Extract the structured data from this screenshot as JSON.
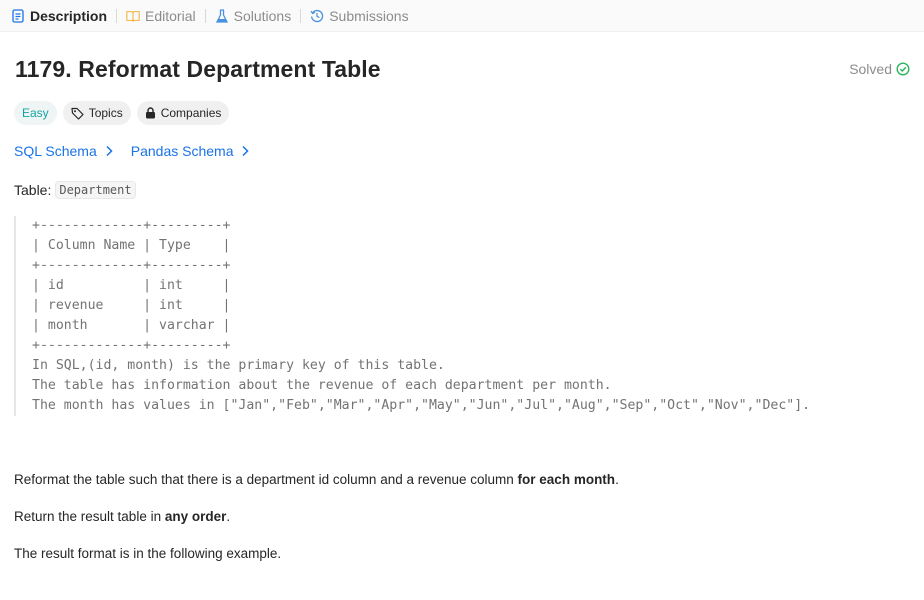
{
  "tabs": [
    {
      "label": "Description",
      "icon": "description-icon",
      "active": true
    },
    {
      "label": "Editorial",
      "icon": "book-icon",
      "active": false
    },
    {
      "label": "Solutions",
      "icon": "flask-icon",
      "active": false
    },
    {
      "label": "Submissions",
      "icon": "history-icon",
      "active": false
    }
  ],
  "problem": {
    "title": "1179. Reformat Department Table",
    "status": "Solved",
    "difficulty": "Easy",
    "topics_label": "Topics",
    "companies_label": "Companies"
  },
  "schemas": {
    "sql": "SQL Schema",
    "pandas": "Pandas Schema"
  },
  "table_intro": {
    "prefix": "Table:",
    "name": "Department"
  },
  "schema_block": "+-------------+---------+\n| Column Name | Type    |\n+-------------+---------+\n| id          | int     |\n| revenue     | int     |\n| month       | varchar |\n+-------------+---------+\nIn SQL,(id, month) is the primary key of this table.\nThe table has information about the revenue of each department per month.\nThe month has values in [\"Jan\",\"Feb\",\"Mar\",\"Apr\",\"May\",\"Jun\",\"Jul\",\"Aug\",\"Sep\",\"Oct\",\"Nov\",\"Dec\"].",
  "description": {
    "p1_text": "Reformat the table such that there is a department id column and a revenue column ",
    "p1_bold": "for each month",
    "p1_end": ".",
    "p2_text": "Return the result table in ",
    "p2_bold": "any order",
    "p2_end": ".",
    "p3": "The result format is in the following example."
  },
  "colors": {
    "easy": "#17a2a2",
    "link": "#1a73e8",
    "solved_check": "#2db55d",
    "tab_active_icon": "#1a73e8",
    "editorial_icon": "#f0b33a",
    "solutions_icon": "#4a90e2",
    "submissions_icon": "#4a90e2"
  }
}
